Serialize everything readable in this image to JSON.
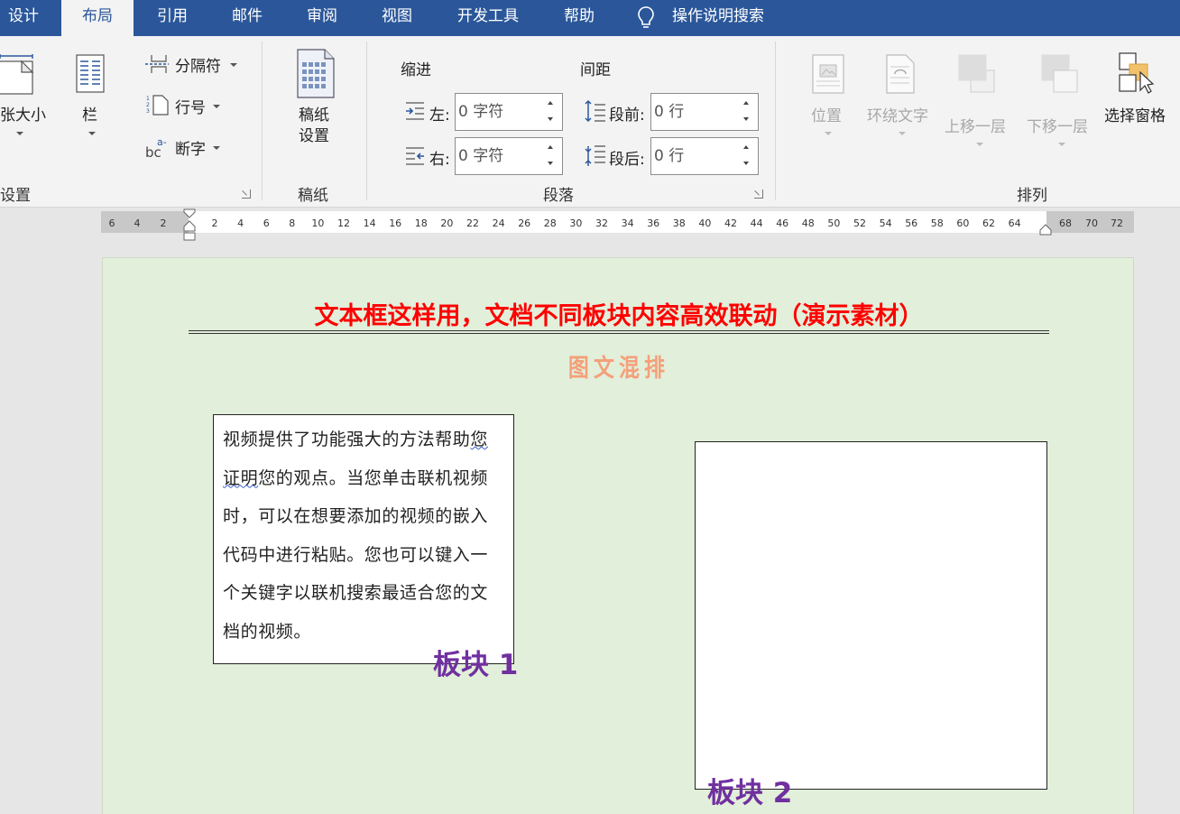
{
  "tabs": [
    "设计",
    "布局",
    "引用",
    "邮件",
    "审阅",
    "视图",
    "开发工具",
    "帮助"
  ],
  "active_tab": "布局",
  "tell_me": "操作说明搜索",
  "ribbon": {
    "page_setup": {
      "size_label": "张大小",
      "columns_label": "栏",
      "breaks_label": "分隔符",
      "line_numbers_label": "行号",
      "hyphenation_label": "断字",
      "group_label": "设置"
    },
    "manuscript": {
      "button_label_line1": "稿纸",
      "button_label_line2": "设置",
      "group_label": "稿纸"
    },
    "paragraph": {
      "indent_header": "缩进",
      "spacing_header": "间距",
      "left_label": "左:",
      "left_value": "0 字符",
      "right_label": "右:",
      "right_value": "0 字符",
      "before_label": "段前:",
      "before_value": "0 行",
      "after_label": "段后:",
      "after_value": "0 行",
      "group_label": "段落"
    },
    "arrange": {
      "position_label": "位置",
      "wrap_text_label": "环绕文字",
      "bring_forward_label": "上移一层",
      "send_backward_label": "下移一层",
      "selection_pane_label": "选择窗格",
      "group_label": "排列"
    }
  },
  "ruler": {
    "left_numbers": [
      "6",
      "4",
      "2"
    ],
    "main_numbers": [
      "2",
      "4",
      "6",
      "8",
      "10",
      "12",
      "14",
      "16",
      "18",
      "20",
      "22",
      "24",
      "26",
      "28",
      "30",
      "32",
      "34",
      "36",
      "38",
      "40",
      "42",
      "44",
      "46",
      "48",
      "50",
      "52",
      "54",
      "56",
      "58",
      "60",
      "62",
      "64"
    ],
    "right_numbers": [
      "68",
      "70",
      "72"
    ]
  },
  "document": {
    "title": "文本框这样用，文档不同板块内容高效联动（演示素材）",
    "subtitle": "图文混排",
    "textbox1_lines": [
      "视频提供了功能强大的方法帮助",
      "证明",
      "您的观点。当您单击联机视频",
      "时，可以在想要添加的视频的嵌入",
      "代码中进行粘贴。您也可以键入一",
      "个关键字以联机搜索最适合您的文",
      "档的视频。"
    ],
    "textbox1_line1_tail": "您",
    "block1_label": "板块 1",
    "block2_label": "板块 2"
  },
  "colors": {
    "tabbar": "#2b579a",
    "title": "#ff0000",
    "subtitle": "#f4a07a",
    "block_label": "#7030a0",
    "page_bg": "#e2efda"
  }
}
